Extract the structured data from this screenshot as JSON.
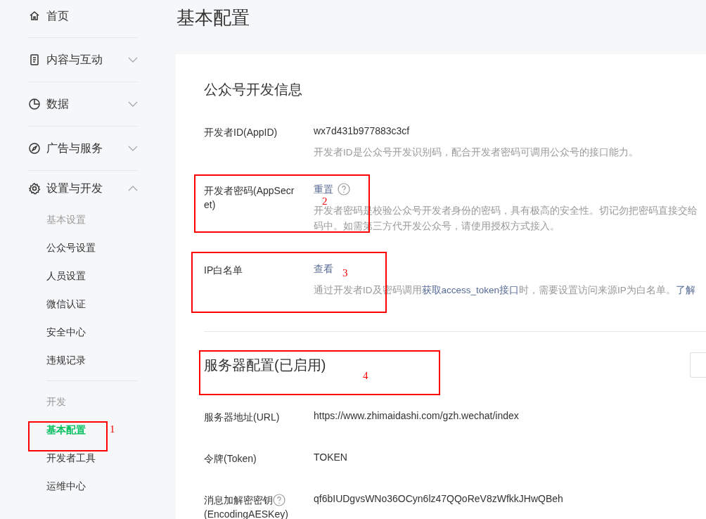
{
  "sidebar": {
    "items": [
      {
        "label": "首页"
      },
      {
        "label": "内容与互动",
        "expanded": false
      },
      {
        "label": "数据",
        "expanded": false
      },
      {
        "label": "广告与服务",
        "expanded": false
      },
      {
        "label": "设置与开发",
        "expanded": true,
        "groups": [
          {
            "title": "基本设置",
            "children": [
              {
                "label": "公众号设置",
                "selected": false
              },
              {
                "label": "人员设置",
                "selected": false
              },
              {
                "label": "微信认证",
                "selected": false
              },
              {
                "label": "安全中心",
                "selected": false
              },
              {
                "label": "违规记录",
                "selected": false
              }
            ]
          },
          {
            "title": "开发",
            "children": [
              {
                "label": "基本配置",
                "selected": true
              },
              {
                "label": "开发者工具",
                "selected": false
              },
              {
                "label": "运维中心",
                "selected": false
              }
            ]
          }
        ]
      }
    ]
  },
  "page_title": "基本配置",
  "sections": [
    {
      "title": "公众号开发信息",
      "rows": [
        {
          "label": "开发者ID(AppID)",
          "value": "wx7d431b977883c3cf",
          "kind": "text",
          "description": [
            "开发者ID是公众号开发识别码，配合开发者密码可调用公众号的接口能力。"
          ]
        },
        {
          "label": "开发者密码(AppSecret)",
          "value": "重置",
          "kind": "link",
          "help": true,
          "description": [
            "开发者密码是校验公众号开发者身份的密码，具有极高的安全性。切记勿把密码直接交给",
            "码中。如需第三方代开发公众号，请使用授权方式接入。"
          ]
        },
        {
          "label": "IP白名单",
          "value": "查看",
          "kind": "link",
          "description_parts": [
            {
              "text": "通过开发者ID及密码调用",
              "link": false
            },
            {
              "text": "获取access_token接口",
              "link": true
            },
            {
              "text": "时，需要设置访问来源IP为白名单。",
              "link": false
            },
            {
              "text": "了解",
              "link": true
            }
          ]
        }
      ]
    },
    {
      "title": "服务器配置(已启用)",
      "rows": [
        {
          "label": "服务器地址(URL)",
          "value": "https://www.zhimaidashi.com/gzh.wechat/index",
          "kind": "text"
        },
        {
          "label": "令牌(Token)",
          "value": "TOKEN",
          "kind": "text"
        },
        {
          "label": "消息加解密密钥",
          "label_extra": "(EncodingAESKey)",
          "value": "qf6bIUDgvsWNo36OCyn6lz47QQoReV8zWfkkJHwQBeh",
          "kind": "text",
          "help": true
        }
      ]
    }
  ],
  "annotations": [
    "1",
    "2",
    "3",
    "4"
  ]
}
